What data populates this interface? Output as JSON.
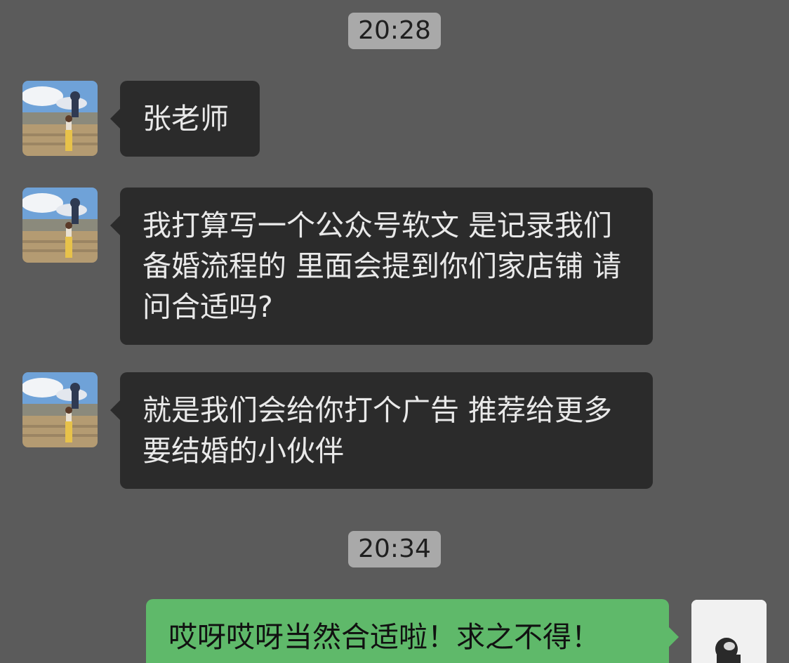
{
  "chat": {
    "timestamps": [
      "20:28",
      "20:34"
    ],
    "messages": [
      {
        "from": "other",
        "text": "张老师"
      },
      {
        "from": "other",
        "text": "我打算写一个公众号软文 是记录我们备婚流程的 里面会提到你们家店铺 请问合适吗?"
      },
      {
        "from": "other",
        "text": "就是我们会给你打个广告 推荐给更多要结婚的小伙伴"
      },
      {
        "from": "self",
        "text": "哎呀哎呀当然合适啦！求之不得！"
      }
    ]
  },
  "colors": {
    "background": "#5b5b5b",
    "incoming_bubble": "#2b2b2b",
    "outgoing_bubble": "#5fb96a",
    "timestamp_pill": "#a9a9a9"
  }
}
